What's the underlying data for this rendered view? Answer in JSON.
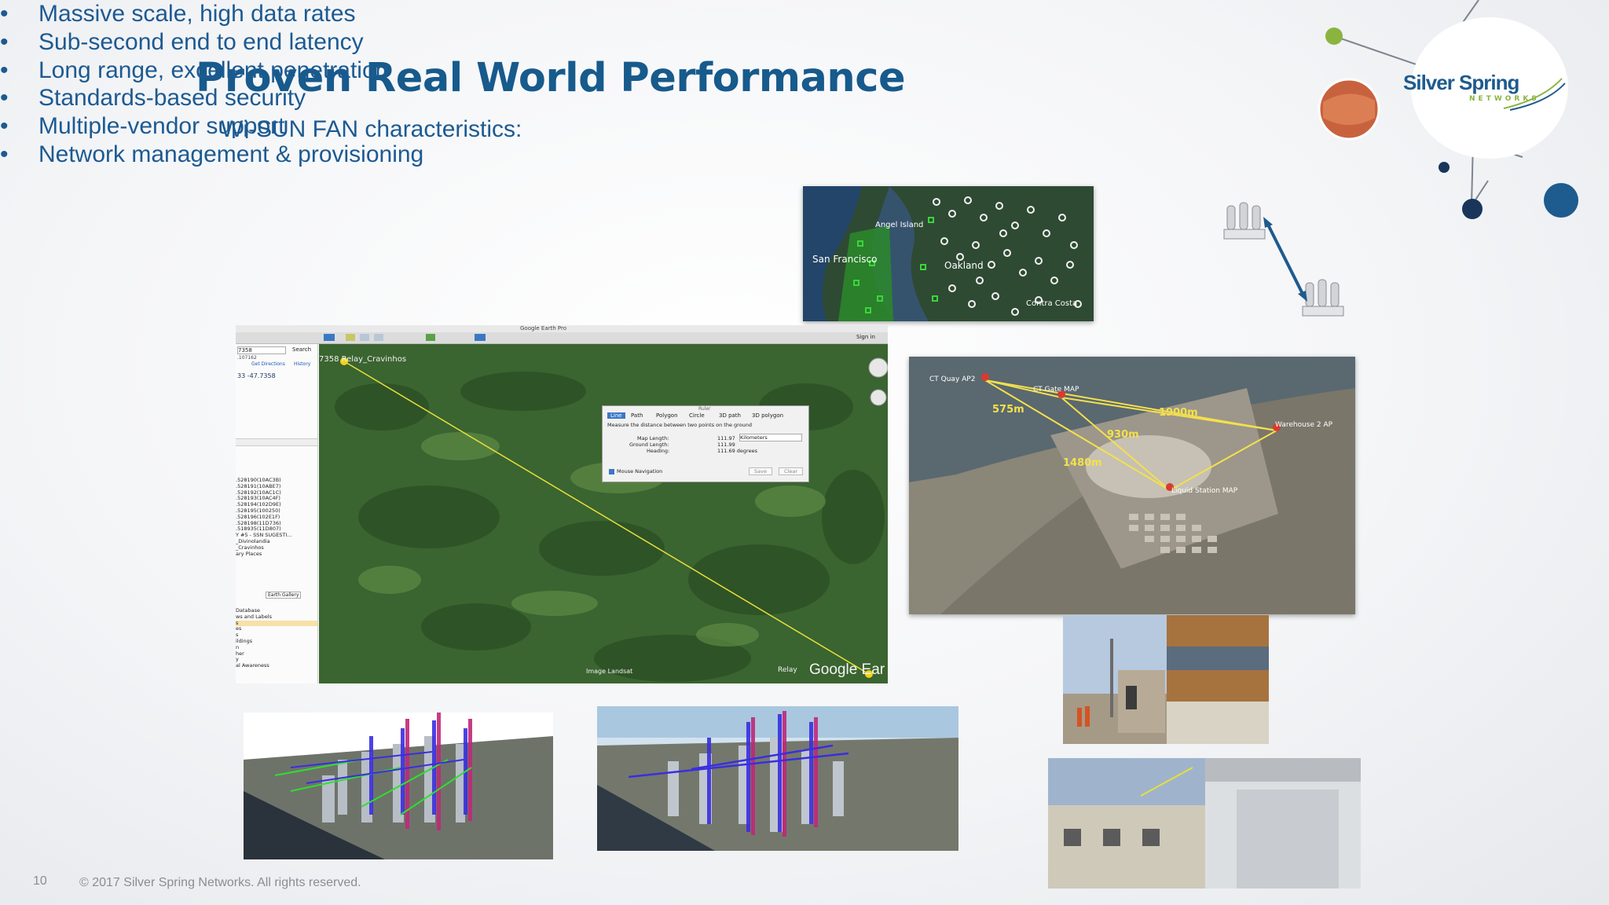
{
  "slide": {
    "title": "Proven Real World Performance",
    "subtitle": "Wi-SUN FAN characteristics:",
    "bullets": [
      "Massive scale, high data rates",
      "Sub-second end to end latency",
      "Long range, excellent penetration",
      "Standards-based security",
      "Multiple-vendor support",
      "Network management & provisioning"
    ],
    "bullet_glyph": "•",
    "page_number": "10",
    "copyright": "© 2017 Silver Spring Networks.  All rights reserved."
  },
  "logo": {
    "name": "Silver Spring",
    "tagline": "NETWORKS"
  },
  "sf_map": {
    "labels": [
      "Angel Island",
      "San Francisco",
      "Oakland",
      "Contra Costa"
    ]
  },
  "google_earth": {
    "window_title": "Google Earth Pro",
    "sign_in": "Sign in",
    "search_value": "7358",
    "search_button": "Search",
    "coord_text": "33 -47.7358",
    "coord_small": ".107162",
    "get_directions": "Get Directions",
    "history": "History",
    "list_items": [
      ".528190(10AC3B)",
      ".528191(10ABE7)",
      ".528192(10AC1C)",
      ".528193(10AC4F)",
      ".528194(102D9E)",
      ".528195(100250)",
      ".528196(102E1F)",
      ".528198(11D736)",
      ".518935(11D807)",
      "Y #5 - SSN SUGESTI...",
      "_Divinolandia",
      "_Cravinhos",
      "ary Places"
    ],
    "earth_gallery": "Earth Gallery",
    "layers": [
      "Database",
      "ws and Labels",
      "s",
      "es",
      "s",
      "ildings",
      "n",
      "her",
      "y",
      "al Awareness"
    ],
    "placemark_left": "7358 Relay_Cravinhos",
    "placemark_right": "Relay",
    "image_credit": "Image Landsat",
    "brand": "Google Ear",
    "ruler": {
      "header": "Ruler",
      "tabs": [
        "Line",
        "Path",
        "Polygon",
        "Circle",
        "3D path",
        "3D polygon"
      ],
      "description": "Measure the distance between two points on the ground",
      "map_length_label": "Map Length:",
      "map_length_value": "111.97",
      "unit": "Kilometers",
      "ground_length_label": "Ground Length:",
      "ground_length_value": "111.99",
      "heading_label": "Heading:",
      "heading_value": "111.69 degrees",
      "mouse_nav": "Mouse Navigation",
      "save": "Save",
      "clear": "Clear"
    }
  },
  "port_map": {
    "labels": [
      "CT Quay AP2",
      "CT Gate MAP",
      "Warehouse 2 AP",
      "Liquid Station MAP"
    ],
    "distances": [
      "575m",
      "1900m",
      "930m",
      "1480m"
    ]
  },
  "colors": {
    "title": "#175a8c",
    "text": "#1c5a92",
    "footer": "#8a8d93",
    "logo_text": "#1e5b8e",
    "distance": "#f4e04d"
  }
}
